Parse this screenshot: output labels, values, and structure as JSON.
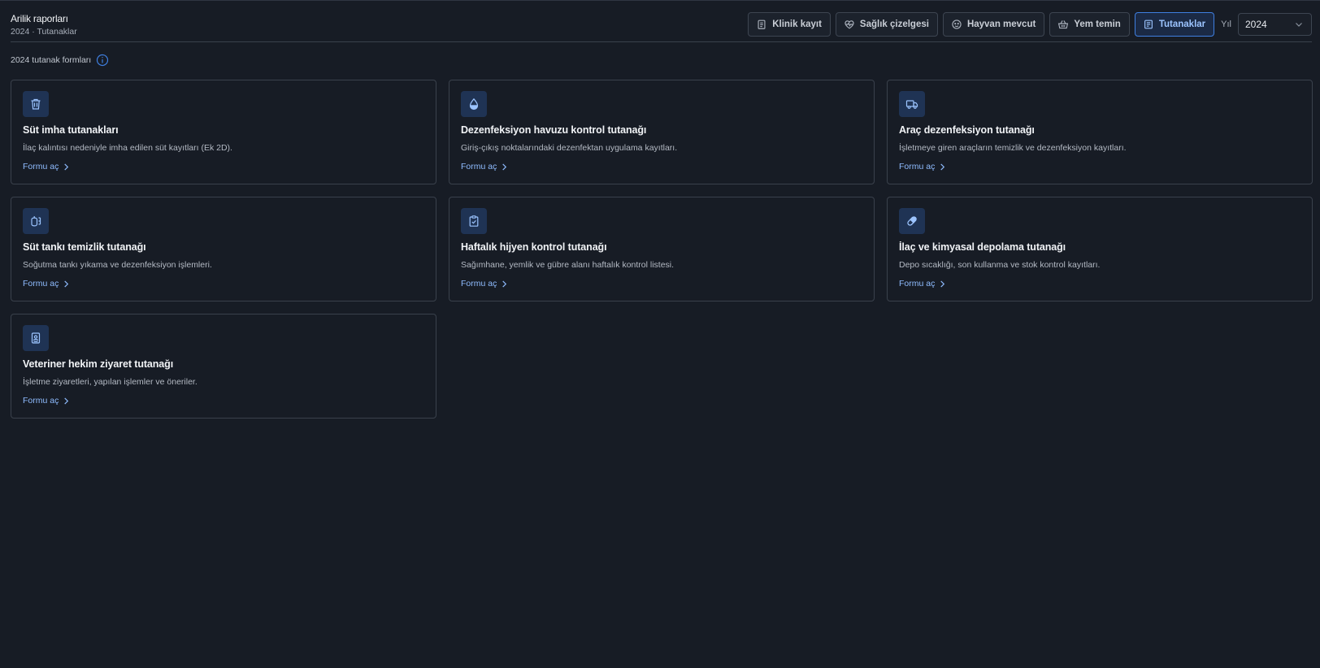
{
  "header": {
    "title": "Arilik raporları",
    "subtitle": "2024 · Tutanaklar"
  },
  "toolbar": {
    "tabs": [
      {
        "label": "Klinik kayıt",
        "icon": "clipboard-icon"
      },
      {
        "label": "Sağlık çizelgesi",
        "icon": "heartbeat-icon"
      },
      {
        "label": "Hayvan mevcut",
        "icon": "animal-face-icon"
      },
      {
        "label": "Yem temin",
        "icon": "basket-icon"
      },
      {
        "label": "Tutanaklar",
        "icon": "document-list-icon",
        "active": true
      }
    ],
    "year_label": "Yıl",
    "year_value": "2024"
  },
  "section": {
    "label": "2024 tutanak formları",
    "info_icon": "info-icon"
  },
  "cards": [
    {
      "title": "Süt imha tutanakları",
      "desc": "İlaç kalıntısı nedeniyle imha edilen süt kayıtları (Ek 2D).",
      "link": "Formu aç",
      "icon": "trash-can-icon"
    },
    {
      "title": "Dezenfeksiyon havuzu kontrol tutanağı",
      "desc": "Giriş-çıkış noktalarındaki dezenfektan uygulama kayıtları.",
      "link": "Formu aç",
      "icon": "droplet-icon"
    },
    {
      "title": "Araç dezenfeksiyon tutanağı",
      "desc": "İşletmeye giren araçların temizlik ve dezenfeksiyon kayıtları.",
      "link": "Formu aç",
      "icon": "truck-icon"
    },
    {
      "title": "Süt tankı temizlik tutanağı",
      "desc": "Soğutma tankı yıkama ve dezenfeksiyon işlemleri.",
      "link": "Formu aç",
      "icon": "tank-icon"
    },
    {
      "title": "Haftalık hijyen kontrol tutanağı",
      "desc": "Sağımhane, yemlik ve gübre alanı haftalık kontrol listesi.",
      "link": "Formu aç",
      "icon": "clipboard-check-icon"
    },
    {
      "title": "İlaç ve kimyasal depolama tutanağı",
      "desc": "Depo sıcaklığı, son kullanma ve stok kontrol kayıtları.",
      "link": "Formu aç",
      "icon": "pill-icon"
    },
    {
      "title": "Veteriner hekim ziyaret tutanağı",
      "desc": "İşletme ziyaretleri, yapılan işlemler ve öneriler.",
      "link": "Formu aç",
      "icon": "id-badge-icon"
    }
  ],
  "colors": {
    "background": "#171c25",
    "accent": "#3f7fe0",
    "link": "#8fbcff",
    "icon_tile": "#1f3354"
  }
}
